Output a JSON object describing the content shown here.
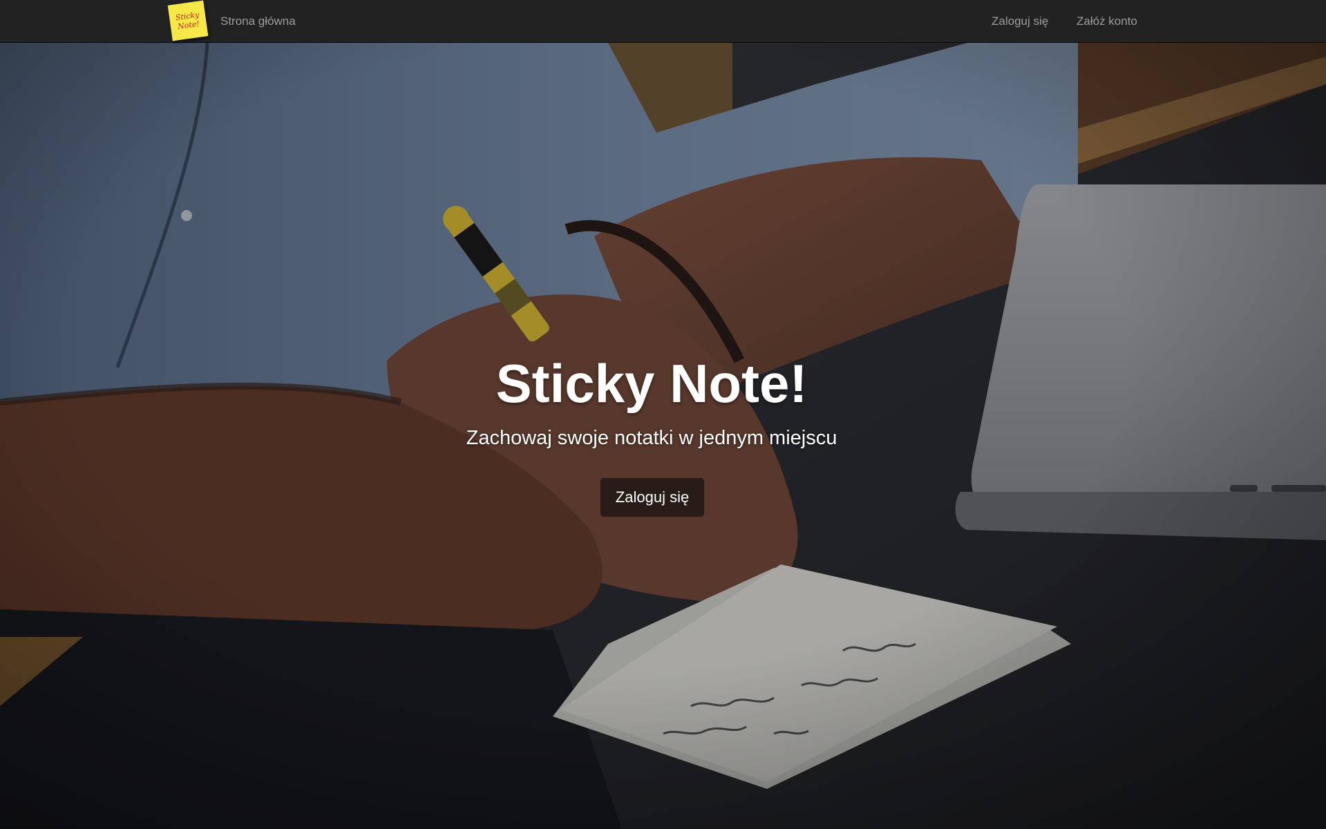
{
  "navbar": {
    "logo_line1": "Sticky",
    "logo_line2": "Note!",
    "home_link": "Strona główna",
    "login_link": "Zaloguj się",
    "register_link": "Załóż konto"
  },
  "hero": {
    "title": "Sticky Note!",
    "subtitle": "Zachowaj swoje notatki w jednym miejscu",
    "button_label": "Zaloguj się"
  },
  "colors": {
    "navbar_bg": "#222222",
    "nav_link": "#9d9d9d",
    "logo_note": "#f7e84a",
    "hero_text": "#ffffff"
  }
}
